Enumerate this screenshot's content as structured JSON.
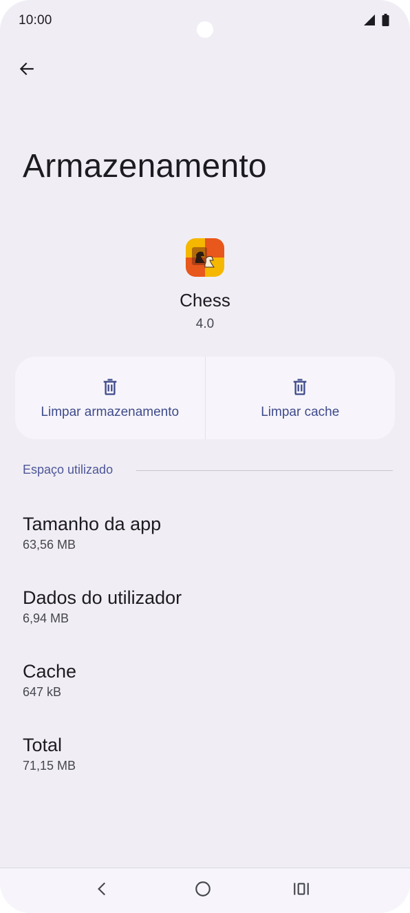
{
  "status_bar": {
    "time": "10:00"
  },
  "page": {
    "title": "Armazenamento"
  },
  "app": {
    "name": "Chess",
    "version": "4.0"
  },
  "actions": {
    "clear_storage_label": "Limpar armazenamento",
    "clear_cache_label": "Limpar cache"
  },
  "section": {
    "header": "Espaço utilizado"
  },
  "storage": [
    {
      "title": "Tamanho da app",
      "value": "63,56 MB"
    },
    {
      "title": "Dados do utilizador",
      "value": "6,94 MB"
    },
    {
      "title": "Cache",
      "value": "647 kB"
    },
    {
      "title": "Total",
      "value": "71,15 MB"
    }
  ],
  "icons": {
    "back": "arrow-back-icon",
    "trash": "trash-icon",
    "nav_back": "chevron-left-icon",
    "nav_home": "home-circle-icon",
    "nav_recents": "recents-icon"
  },
  "colors": {
    "background": "#f0eef4",
    "card": "#f7f5fb",
    "accent": "#3e4a8a",
    "section_header": "#4c5598"
  }
}
